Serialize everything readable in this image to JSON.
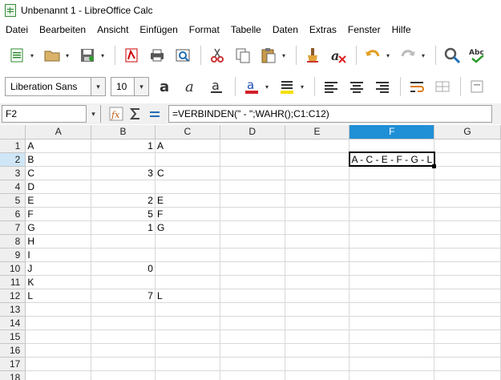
{
  "window": {
    "title": "Unbenannt 1 - LibreOffice Calc"
  },
  "menu": [
    "Datei",
    "Bearbeiten",
    "Ansicht",
    "Einfügen",
    "Format",
    "Tabelle",
    "Daten",
    "Extras",
    "Fenster",
    "Hilfe"
  ],
  "toolbar2": {
    "font_name": "Liberation Sans",
    "font_size": "10"
  },
  "formula_bar": {
    "cell_ref": "F2",
    "content": "=VERBINDEN(\" - \";WAHR();C1:C12)"
  },
  "sheet": {
    "columns": [
      "A",
      "B",
      "C",
      "D",
      "E",
      "F",
      "G"
    ],
    "active_column": "F",
    "active_row": 2,
    "rows": [
      {
        "n": "1",
        "A": "A",
        "B": "1",
        "C": "A",
        "F": ""
      },
      {
        "n": "2",
        "A": "B",
        "B": "",
        "C": "",
        "F": "A - C - E - F - G - L"
      },
      {
        "n": "3",
        "A": "C",
        "B": "3",
        "C": "C",
        "F": ""
      },
      {
        "n": "4",
        "A": "D",
        "B": "",
        "C": "",
        "F": ""
      },
      {
        "n": "5",
        "A": "E",
        "B": "2",
        "C": "E",
        "F": ""
      },
      {
        "n": "6",
        "A": "F",
        "B": "5",
        "C": "F",
        "F": ""
      },
      {
        "n": "7",
        "A": "G",
        "B": "1",
        "C": "G",
        "F": ""
      },
      {
        "n": "8",
        "A": "H",
        "B": "",
        "C": "",
        "F": ""
      },
      {
        "n": "9",
        "A": "I",
        "B": "",
        "C": "",
        "F": ""
      },
      {
        "n": "10",
        "A": "J",
        "B": "0",
        "C": "",
        "F": ""
      },
      {
        "n": "11",
        "A": "K",
        "B": "",
        "C": "",
        "F": ""
      },
      {
        "n": "12",
        "A": "L",
        "B": "7",
        "C": "L",
        "F": ""
      },
      {
        "n": "13",
        "A": "",
        "B": "",
        "C": "",
        "F": ""
      },
      {
        "n": "14",
        "A": "",
        "B": "",
        "C": "",
        "F": ""
      },
      {
        "n": "15",
        "A": "",
        "B": "",
        "C": "",
        "F": ""
      },
      {
        "n": "16",
        "A": "",
        "B": "",
        "C": "",
        "F": ""
      },
      {
        "n": "17",
        "A": "",
        "B": "",
        "C": "",
        "F": ""
      },
      {
        "n": "18",
        "A": "",
        "B": "",
        "C": "",
        "F": ""
      }
    ]
  },
  "colors": {
    "active_header": "#1f8fd6",
    "active_row_header": "#cfe6f7",
    "grid": "#d8d8d8"
  },
  "icons": [
    "calc-app-icon",
    "new-document-icon",
    "open-folder-icon",
    "save-icon",
    "export-pdf-icon",
    "print-icon",
    "print-preview-icon",
    "cut-icon",
    "copy-icon",
    "paste-icon",
    "clone-formatting-icon",
    "clear-formatting-icon",
    "undo-icon",
    "redo-icon",
    "find-replace-icon",
    "spellcheck-icon",
    "bold-icon",
    "italic-icon",
    "underline-icon",
    "font-color-icon",
    "highlight-color-icon",
    "align-left-icon",
    "align-center-icon",
    "align-right-icon",
    "wrap-text-icon",
    "merge-cells-icon",
    "function-wizard-icon",
    "sum-icon",
    "formula-icon"
  ]
}
